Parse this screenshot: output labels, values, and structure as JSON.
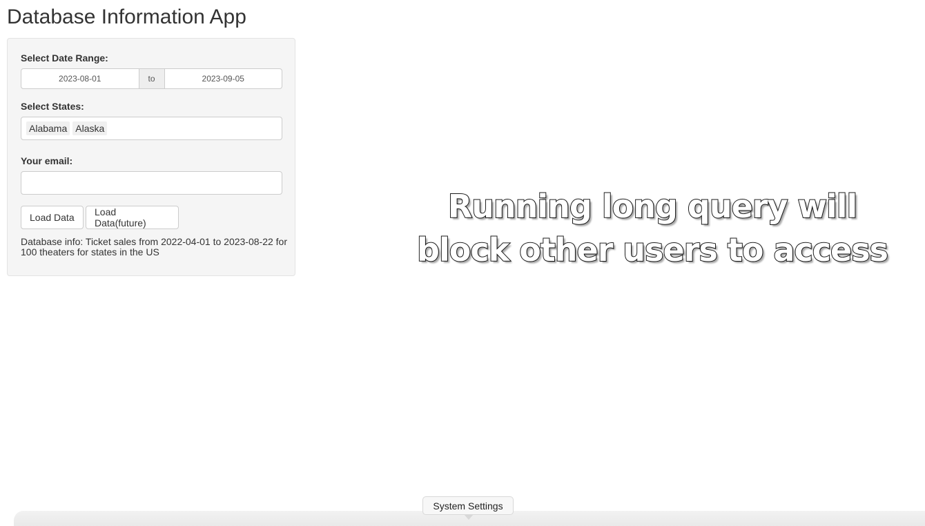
{
  "app": {
    "title": "Database Information App"
  },
  "sidebar": {
    "date_range": {
      "label": "Select Date Range:",
      "start": "2023-08-01",
      "separator": "to",
      "end": "2023-09-05"
    },
    "states": {
      "label": "Select States:",
      "selected": [
        "Alabama",
        "Alaska"
      ]
    },
    "email": {
      "label": "Your email:",
      "value": ""
    },
    "buttons": {
      "load": "Load Data",
      "load_future": "Load Data(future)"
    },
    "info_text": "Database info: Ticket sales from 2022-04-01 to 2023-08-22 for 100 theaters for states in the US"
  },
  "overlay": {
    "line1": "Running long query will",
    "line2": "block other users to access"
  },
  "dock": {
    "tooltip": "System Settings"
  }
}
